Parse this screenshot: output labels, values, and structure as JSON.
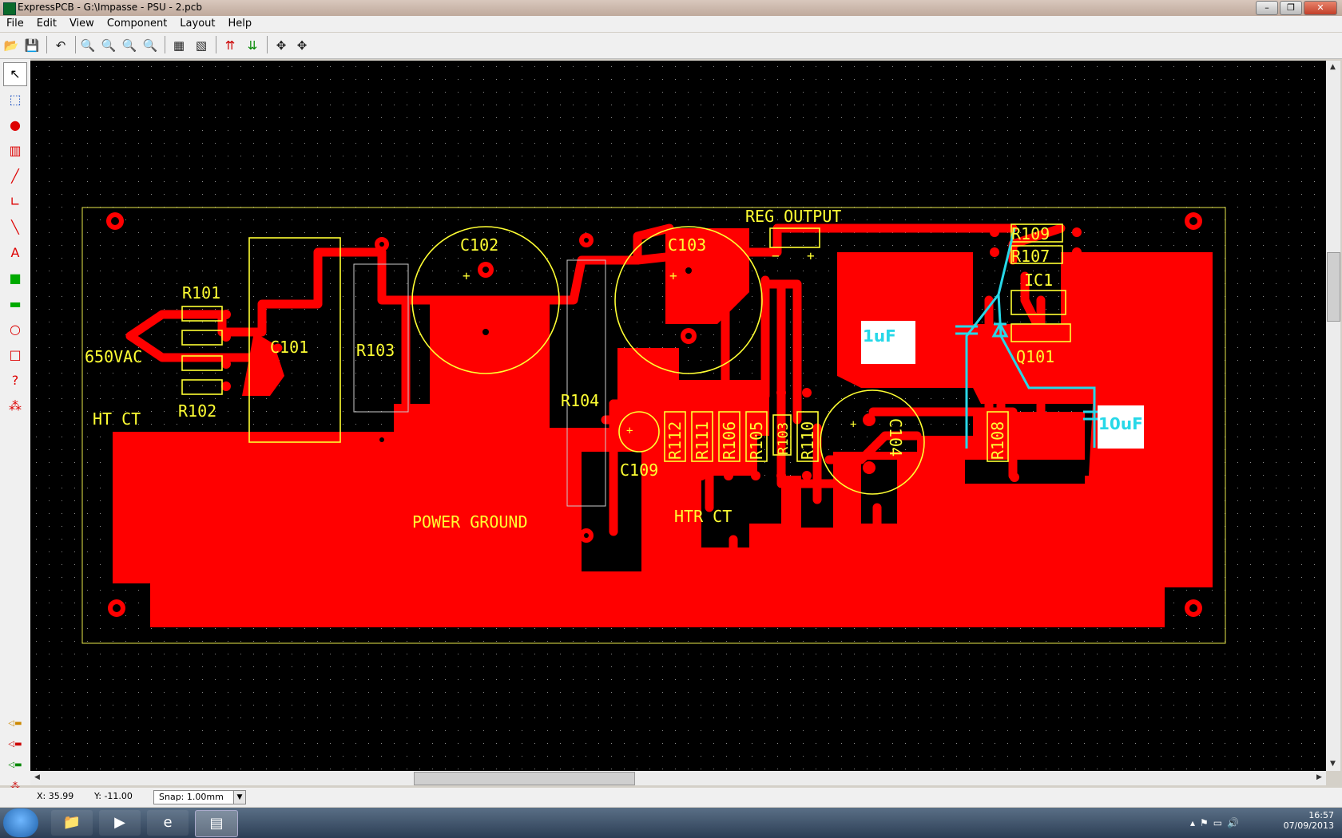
{
  "window": {
    "title": "ExpressPCB - G:\\Impasse - PSU - 2.pcb"
  },
  "menu": [
    "File",
    "Edit",
    "View",
    "Component",
    "Layout",
    "Help"
  ],
  "toolbar": [
    {
      "name": "open-icon",
      "glyph": "📂"
    },
    {
      "name": "save-icon",
      "glyph": "💾"
    },
    {
      "name": "undo-icon",
      "glyph": "↶"
    },
    {
      "name": "zoom-in-icon",
      "glyph": "🔍"
    },
    {
      "name": "zoom-out-icon",
      "glyph": "🔍"
    },
    {
      "name": "zoom-fit-icon",
      "glyph": "🔍"
    },
    {
      "name": "zoom-previous-icon",
      "glyph": "🔍"
    },
    {
      "name": "properties-icon",
      "glyph": "▦"
    },
    {
      "name": "print-icon",
      "glyph": "▧"
    },
    {
      "name": "top-layer-icon",
      "glyph": "⇈"
    },
    {
      "name": "bottom-layer-icon",
      "glyph": "⇊"
    },
    {
      "name": "move-icon",
      "glyph": "✥"
    },
    {
      "name": "rotate-icon",
      "glyph": "✥"
    }
  ],
  "left_tools": [
    {
      "name": "pointer-tool-icon",
      "glyph": "↖"
    },
    {
      "name": "select-area-icon",
      "glyph": "⬚"
    },
    {
      "name": "pad-tool-icon",
      "glyph": "●"
    },
    {
      "name": "component-tool-icon",
      "glyph": "▥"
    },
    {
      "name": "trace-tool-icon",
      "glyph": "╱"
    },
    {
      "name": "angle-tool-icon",
      "glyph": "∟"
    },
    {
      "name": "line-tool-icon",
      "glyph": "╲"
    },
    {
      "name": "text-tool-icon",
      "glyph": "A"
    },
    {
      "name": "fill-tool-icon",
      "glyph": "■"
    },
    {
      "name": "board-tool-icon",
      "glyph": "▬"
    },
    {
      "name": "circle-tool-icon",
      "glyph": "○"
    },
    {
      "name": "rectangle-tool-icon",
      "glyph": "□"
    },
    {
      "name": "query-tool-icon",
      "glyph": "?"
    },
    {
      "name": "netlist-tool-icon",
      "glyph": "⁂"
    }
  ],
  "layer_buttons": [
    {
      "name": "layer-silk-icon",
      "glyph": "◁▬"
    },
    {
      "name": "layer-top-icon",
      "glyph": "◁▬"
    },
    {
      "name": "layer-bottom-icon",
      "glyph": "◁▬"
    },
    {
      "name": "layer-ratsnest-icon",
      "glyph": "⁂"
    }
  ],
  "pcb_labels": {
    "r101": "R101",
    "r102": "R102",
    "r103": "R103",
    "r104": "R104",
    "c101": "C101",
    "c102": "C102",
    "c103": "C103",
    "c104": "C104",
    "c109": "C109",
    "vac": "650VAC",
    "ht_ct": "HT CT",
    "power_ground": "POWER GROUND",
    "htr_ct": "HTR CT",
    "reg_output": "REG OUTPUT",
    "r109": "R109",
    "r107": "R107",
    "ic1": "IC1",
    "q101": "Q101",
    "r112": "R112",
    "r111": "R111",
    "r106": "R106",
    "r105": "R105",
    "r103b": "R103",
    "r110": "R110",
    "r108": "R108",
    "note_1uf": "1uF",
    "note_10uf": "10uF",
    "plus": "+",
    "minus": "−"
  },
  "colors": {
    "copper": "#ff0000",
    "silk": "#ffff33",
    "annotation": "#27d8e8",
    "background": "#000000"
  },
  "status": {
    "x": "X: 35.99",
    "y": "Y: -11.00",
    "snap": "Snap: 1.00mm"
  },
  "clock": {
    "time": "16:57",
    "date": "07/09/2013"
  }
}
